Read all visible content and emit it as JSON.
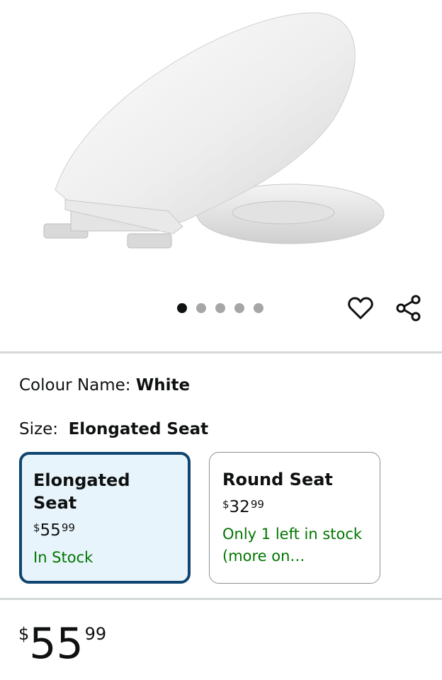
{
  "gallery": {
    "image_alt": "White elongated toilet seat with lid open",
    "dots_total": 5,
    "active_index": 0
  },
  "actions": {
    "favorite_icon": "heart-icon",
    "share_icon": "share-icon"
  },
  "colour": {
    "label": "Colour Name:",
    "value": "White"
  },
  "size": {
    "label": "Size:",
    "value": "Elongated Seat",
    "options": [
      {
        "title": "Elongated Seat",
        "currency": "$",
        "price_whole": "55",
        "price_fraction": "99",
        "stock": "In Stock",
        "selected": true
      },
      {
        "title": "Round Seat",
        "currency": "$",
        "price_whole": "32",
        "price_fraction": "99",
        "stock": "Only 1 left in stock (more on…",
        "selected": false
      }
    ]
  },
  "price": {
    "currency": "$",
    "whole": "55",
    "fraction": "99"
  },
  "colors": {
    "selected_border": "#0f4570",
    "selected_bg": "#e8f4fb",
    "stock_green": "#007600",
    "divider": "#d5d9d9"
  }
}
